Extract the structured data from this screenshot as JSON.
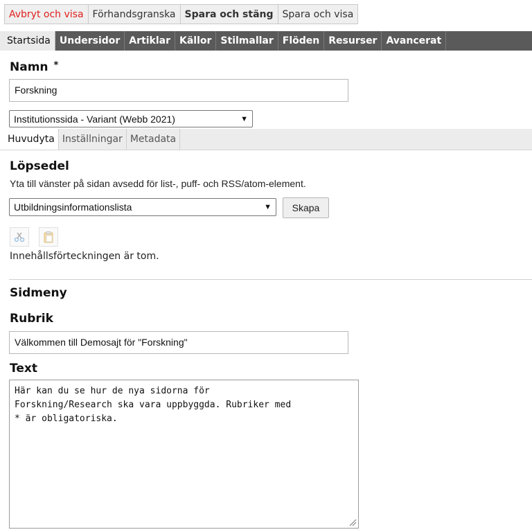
{
  "actions": {
    "cancel_view": "Avbryt och visa",
    "preview": "Förhandsgranska",
    "save_close": "Spara och stäng",
    "save_view": "Spara och visa"
  },
  "tabs": [
    "Startsida",
    "Undersidor",
    "Artiklar",
    "Källor",
    "Stilmallar",
    "Flöden",
    "Resurser",
    "Avancerat"
  ],
  "name_field": {
    "label": "Namn",
    "required_marker": "*",
    "value": "Forskning"
  },
  "template_select": {
    "selected": "Institutionssida - Variant (Webb 2021)"
  },
  "subtabs": [
    "Huvudyta",
    "Inställningar",
    "Metadata"
  ],
  "lopsedel": {
    "heading": "Löpsedel",
    "description": "Yta till vänster på sidan avsedd för list-, puff- och RSS/atom-element.",
    "select_value": "Utbildningsinformationslista",
    "create_button": "Skapa",
    "empty_text": "Innehållsförteckningen är tom."
  },
  "sidmeny": {
    "heading": "Sidmeny",
    "rubrik_label": "Rubrik",
    "rubrik_value": "Välkommen till Demosajt för \"Forskning\"",
    "text_label": "Text",
    "text_value": "Här kan du se hur de nya sidorna för\nForskning/Research ska vara uppbyggda. Rubriker med\n* är obligatoriska."
  },
  "colors": {
    "cancel_text": "#e0201e",
    "tabbar_bg": "#5a5a5a"
  }
}
